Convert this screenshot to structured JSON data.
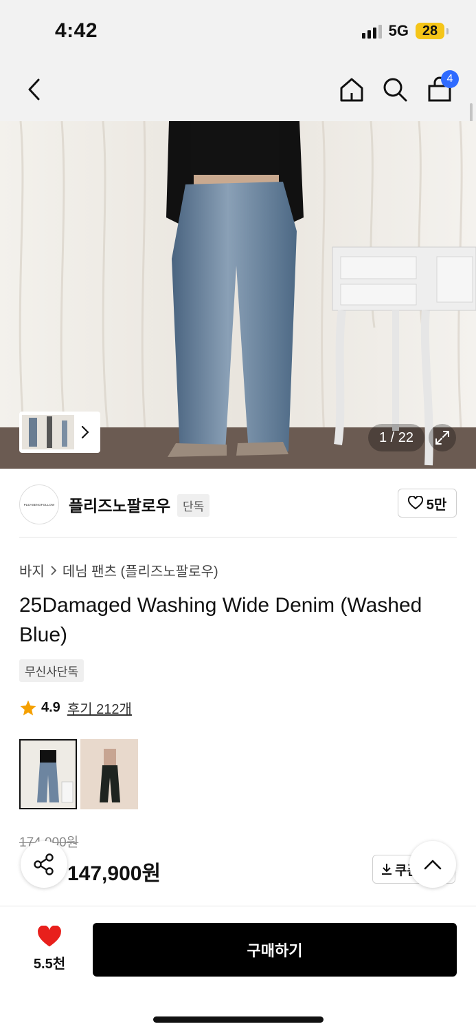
{
  "status": {
    "time": "4:42",
    "network": "5G",
    "battery": "28"
  },
  "nav": {
    "cart_count": "4"
  },
  "gallery": {
    "counter": "1 / 22"
  },
  "brand": {
    "name": "플리즈노팔로우",
    "tag": "단독",
    "logo_text": "PLEASENOFOLLOW",
    "likes": "5만"
  },
  "breadcrumb": {
    "category": "바지",
    "subcategory": "데님 팬츠 (플리즈노팔로우)"
  },
  "product": {
    "title": "25Damaged Washing Wide Denim (Washed Blue)",
    "badge": "무신사단독",
    "rating": "4.9",
    "reviews": "후기 212개",
    "original_price": "174,000원",
    "sale_price": "147,900원",
    "coupon_label": "쿠폰"
  },
  "bottom": {
    "wish_count": "5.5천",
    "buy_label": "구매하기"
  },
  "colors": {
    "accent": "#2f6bff",
    "heart": "#e8201c",
    "star": "#f5a000",
    "buy_bg": "#000000"
  }
}
